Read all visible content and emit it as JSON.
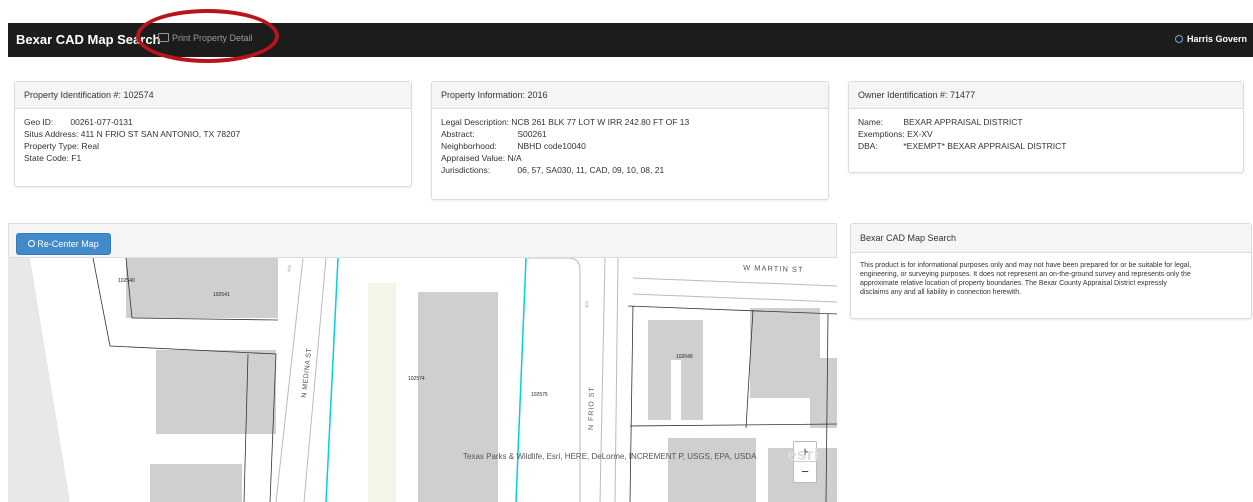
{
  "navbar": {
    "brand": "Bexar CAD Map Search",
    "print_link": "Print Property Detail",
    "harris_link": "Harris Govern"
  },
  "property_panel": {
    "heading": "Property Identification #: 102574",
    "rows": [
      {
        "label": "Geo ID:",
        "value": "00261-077-0131"
      },
      {
        "label": "Situs Address:",
        "value": "411 N FRIO ST SAN ANTONIO, TX 78207"
      },
      {
        "label": "Property Type:",
        "value": "Real"
      },
      {
        "label": "State Code:",
        "value": "F1"
      }
    ]
  },
  "info_panel": {
    "heading": "Property Information: 2016",
    "rows": [
      {
        "label": "Legal Description:",
        "value": "NCB 261 BLK 77 LOT W IRR 242.80 FT OF 13"
      },
      {
        "label": "Abstract:",
        "value": "S00261"
      },
      {
        "label": "Neighborhood:",
        "value": "NBHD code10040"
      },
      {
        "label": "Appraised Value:",
        "value": "N/A"
      },
      {
        "label": "Jurisdictions:",
        "value": "06, 57, SA030, 11, CAD, 09, 10, 08, 21"
      }
    ]
  },
  "owner_panel": {
    "heading": "Owner Identification #: 71477",
    "rows": [
      {
        "label": "Name:",
        "value": "BEXAR APPRAISAL DISTRICT"
      },
      {
        "label": "Exemptions:",
        "value": "EX-XV"
      },
      {
        "label": "DBA:",
        "value": "*EXEMPT* BEXAR APPRAISAL DISTRICT"
      }
    ]
  },
  "disclaimer_panel": {
    "heading": "Bexar CAD Map Search",
    "lines": [
      "This product is for informational purposes only and may not have been prepared for or be suitable for legal,",
      "engineering, or surveying purposes. It does not represent an on-the-ground survey and represents only the",
      "approximate relative location of property boundaries. The Bexar County Appraisal District expressly",
      "disclaims any and all liability in connection herewith."
    ]
  },
  "map": {
    "recenter_label": "Re-Center Map",
    "zoom_in": "+",
    "zoom_out": "−",
    "attribution": "Texas Parks & Wildlife, Esri, HERE, DeLorme, INCREMENT P, USGS, EPA, USDA",
    "esri_logo": "esri",
    "streets": {
      "martin": "W MARTIN ST",
      "medina": "N MEDINA ST",
      "frio": "N FRIO ST"
    },
    "parcels": [
      "102540",
      "102541",
      "102574",
      "102575",
      "102049"
    ],
    "road_shields": [
      "403",
      "403"
    ]
  },
  "colors": {
    "navbar": "#1c1c1c",
    "annotation": "#b8141a",
    "button": "#428bca",
    "selected_parcel": "#00d0e0"
  }
}
